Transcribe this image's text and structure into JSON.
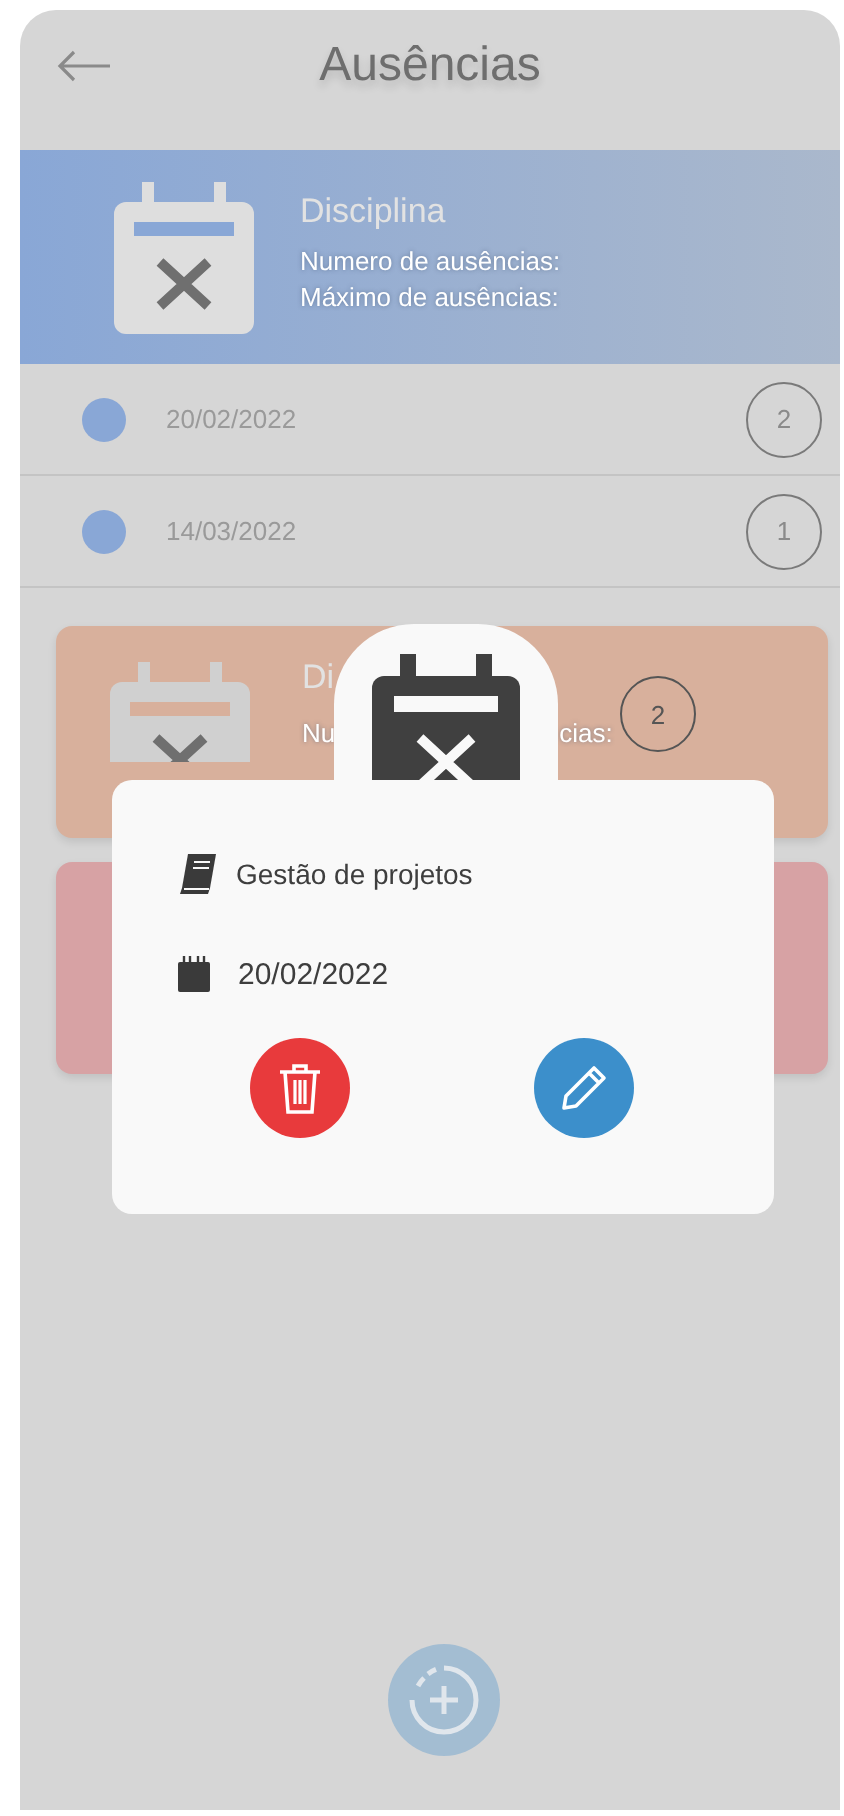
{
  "header": {
    "title": "Ausências"
  },
  "subjects": [
    {
      "kind": "band",
      "title": "Disciplina",
      "lines": [
        "Numero de ausências:",
        "Máximo de ausências:"
      ],
      "color": "#89a7d6",
      "absences": [
        {
          "date": "20/02/2022",
          "count": "2"
        },
        {
          "date": "14/03/2022",
          "count": "1"
        }
      ]
    },
    {
      "kind": "card",
      "title": "Di",
      "lines": [
        "Nu",
        "cias:"
      ],
      "color": "#d8b09c",
      "badge": "2"
    },
    {
      "kind": "card",
      "color": "#d7a2a4"
    }
  ],
  "dialog": {
    "subject": "Gestão de projetos",
    "date": "20/02/2022"
  }
}
